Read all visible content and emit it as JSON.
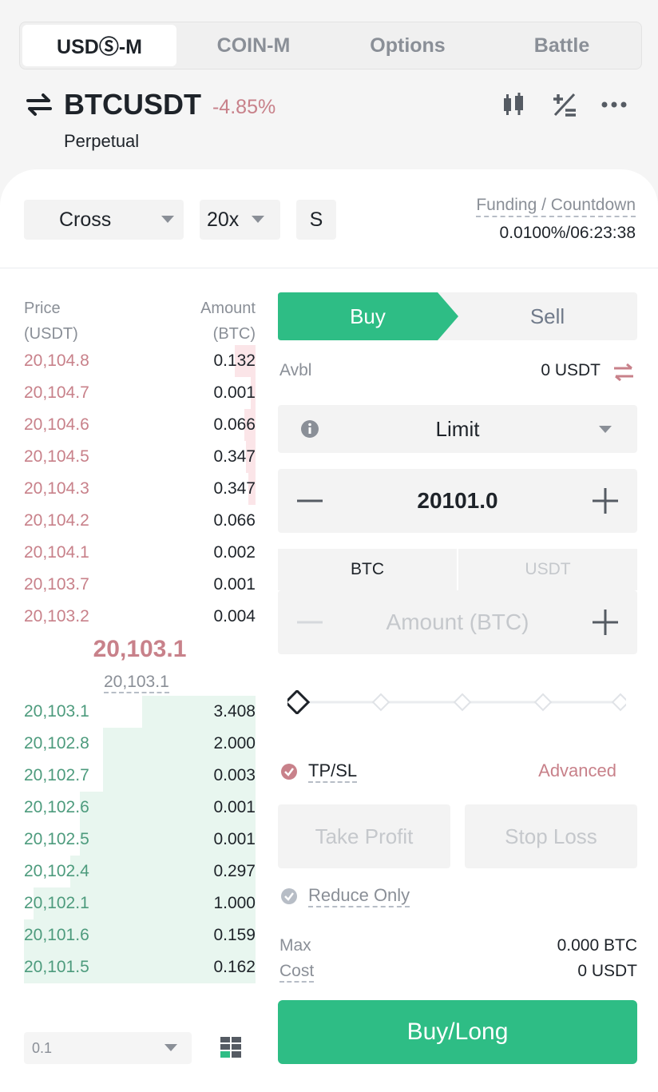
{
  "tabs": [
    {
      "label": "USDⓈ-M",
      "active": true
    },
    {
      "label": "COIN-M",
      "active": false
    },
    {
      "label": "Options",
      "active": false
    },
    {
      "label": "Battle",
      "active": false
    }
  ],
  "header": {
    "symbol": "BTCUSDT",
    "change": "-4.85%",
    "subtitle": "Perpetual",
    "icons": [
      "swap-arrows-icon",
      "candlestick-chart-icon",
      "plus-minus-calculator-icon",
      "more-icon"
    ]
  },
  "controls": {
    "margin_mode": "Cross",
    "leverage": "20x",
    "mode_short": "S",
    "funding_label": "Funding / Countdown",
    "funding_value": "0.0100%/06:23:38"
  },
  "orderbook": {
    "price_header": "Price\n(USDT)",
    "price_header_line1": "Price",
    "price_header_line2": "(USDT)",
    "amount_header_line1": "Amount",
    "amount_header_line2": "(BTC)",
    "asks": [
      {
        "price": "20,104.8",
        "amount": "0.132",
        "depth": 0.09
      },
      {
        "price": "20,104.7",
        "amount": "0.001",
        "depth": 0.02
      },
      {
        "price": "20,104.6",
        "amount": "0.066",
        "depth": 0.05
      },
      {
        "price": "20,104.5",
        "amount": "0.347",
        "depth": 0.04
      },
      {
        "price": "20,104.3",
        "amount": "0.347",
        "depth": 0.03
      },
      {
        "price": "20,104.2",
        "amount": "0.066",
        "depth": 0.0
      },
      {
        "price": "20,104.1",
        "amount": "0.002",
        "depth": 0.0
      },
      {
        "price": "20,103.7",
        "amount": "0.001",
        "depth": 0.0
      },
      {
        "price": "20,103.2",
        "amount": "0.004",
        "depth": 0.0
      }
    ],
    "last_price": "20,103.1",
    "mark_price": "20,103.1",
    "bids": [
      {
        "price": "20,103.1",
        "amount": "3.408",
        "depth": 0.49
      },
      {
        "price": "20,102.8",
        "amount": "2.000",
        "depth": 0.66
      },
      {
        "price": "20,102.7",
        "amount": "0.003",
        "depth": 0.66
      },
      {
        "price": "20,102.6",
        "amount": "0.001",
        "depth": 0.76
      },
      {
        "price": "20,102.5",
        "amount": "0.001",
        "depth": 0.76
      },
      {
        "price": "20,102.4",
        "amount": "0.297",
        "depth": 0.8
      },
      {
        "price": "20,102.1",
        "amount": "1.000",
        "depth": 0.96
      },
      {
        "price": "20,101.6",
        "amount": "0.159",
        "depth": 1.0
      },
      {
        "price": "20,101.5",
        "amount": "0.162",
        "depth": 1.0
      }
    ],
    "precision": "0.1"
  },
  "form": {
    "buy_label": "Buy",
    "sell_label": "Sell",
    "avbl_label": "Avbl",
    "avbl_value": "0 USDT",
    "order_type": "Limit",
    "price": "20101.0",
    "unit_active": "BTC",
    "unit_inactive": "USDT",
    "amount_placeholder": "Amount (BTC)",
    "slider_percent": 0,
    "tpsl_label": "TP/SL",
    "advanced_label": "Advanced",
    "take_profit": "Take Profit",
    "stop_loss": "Stop Loss",
    "reduce_only": "Reduce Only",
    "max_label": "Max",
    "max_value": "0.000 BTC",
    "cost_label": "Cost",
    "cost_value": "0 USDT",
    "submit": "Buy/Long"
  },
  "colors": {
    "buy": "#2ebd85",
    "sell": "#c8818a",
    "bid_text": "#4d9b7d"
  }
}
